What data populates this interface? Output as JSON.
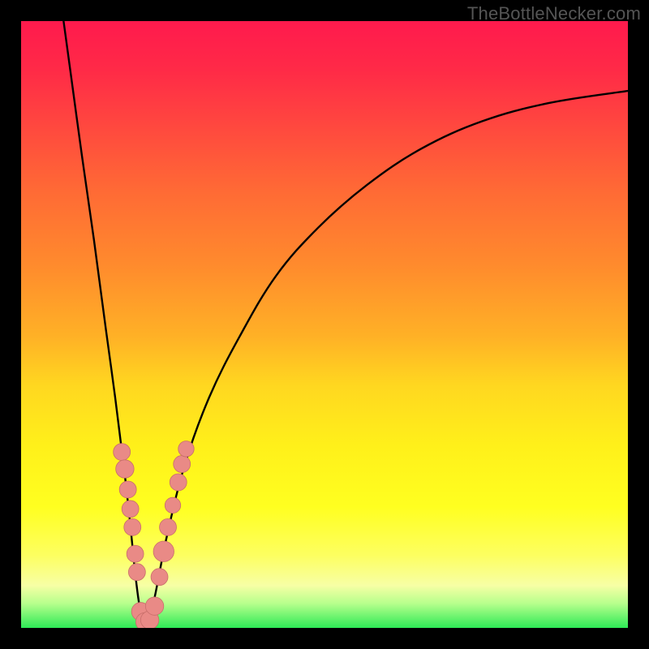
{
  "attribution": "TheBottleNecker.com",
  "colors": {
    "frame": "#000000",
    "curve": "#000000",
    "marker_fill": "#e98a86",
    "marker_stroke": "#c86e6a",
    "gradient_top": "#ff1a4d",
    "gradient_bottom": "#2eea56"
  },
  "chart_data": {
    "type": "line",
    "title": "",
    "xlabel": "",
    "ylabel": "",
    "xlim": [
      0,
      100
    ],
    "ylim": [
      0,
      100
    ],
    "series": [
      {
        "name": "left-branch",
        "x": [
          7,
          8.5,
          10,
          12,
          14,
          15.5,
          17,
          18,
          18.7,
          19.3,
          19.8,
          20.3
        ],
        "values": [
          100,
          89,
          78,
          64,
          49,
          38,
          26,
          17,
          10,
          5,
          2,
          0.5
        ]
      },
      {
        "name": "right-branch",
        "x": [
          20.8,
          22,
          24,
          27,
          31,
          36,
          42,
          49,
          57,
          66,
          76,
          87,
          100
        ],
        "values": [
          0.5,
          5,
          15,
          27,
          38,
          48,
          58,
          66,
          73,
          79,
          83.5,
          86.5,
          88.5
        ]
      }
    ],
    "markers": {
      "left_cluster": [
        {
          "x": 16.6,
          "y": 29,
          "r": 1.4
        },
        {
          "x": 17.1,
          "y": 26.2,
          "r": 1.5
        },
        {
          "x": 17.6,
          "y": 22.8,
          "r": 1.4
        },
        {
          "x": 18.0,
          "y": 19.6,
          "r": 1.4
        },
        {
          "x": 18.35,
          "y": 16.6,
          "r": 1.4
        },
        {
          "x": 18.8,
          "y": 12.2,
          "r": 1.4
        },
        {
          "x": 19.1,
          "y": 9.2,
          "r": 1.4
        }
      ],
      "bottom_cluster": [
        {
          "x": 19.7,
          "y": 2.7,
          "r": 1.5
        },
        {
          "x": 20.4,
          "y": 1.0,
          "r": 1.5
        },
        {
          "x": 21.2,
          "y": 1.3,
          "r": 1.5
        },
        {
          "x": 22.0,
          "y": 3.6,
          "r": 1.5
        }
      ],
      "right_cluster": [
        {
          "x": 22.8,
          "y": 8.4,
          "r": 1.4
        },
        {
          "x": 23.5,
          "y": 12.6,
          "r": 1.7
        },
        {
          "x": 24.2,
          "y": 16.6,
          "r": 1.4
        },
        {
          "x": 25.0,
          "y": 20.2,
          "r": 1.3
        },
        {
          "x": 25.9,
          "y": 24.0,
          "r": 1.4
        },
        {
          "x": 26.5,
          "y": 27.0,
          "r": 1.4
        },
        {
          "x": 27.2,
          "y": 29.5,
          "r": 1.3
        }
      ]
    }
  }
}
